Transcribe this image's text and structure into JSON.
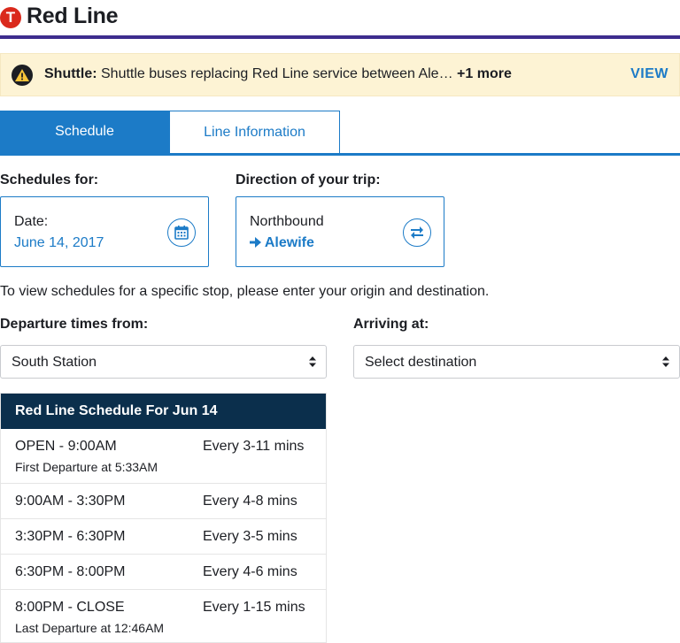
{
  "header": {
    "logo_text": "T",
    "title": "Red Line",
    "line_color": "#3d2d8e",
    "logo_color": "#da291c"
  },
  "alert": {
    "icon": "warning-icon",
    "label": "Shuttle:",
    "message": "Shuttle buses replacing Red Line service between Ale…",
    "more": "+1 more",
    "action": "VIEW"
  },
  "tabs": [
    {
      "label": "Schedule",
      "active": true
    },
    {
      "label": "Line Information",
      "active": false
    }
  ],
  "schedules_for": {
    "heading": "Schedules for:",
    "field_label": "Date:",
    "value": "June 14, 2017",
    "icon": "calendar-icon"
  },
  "direction": {
    "heading": "Direction of your trip:",
    "value": "Northbound",
    "destination": "Alewife",
    "icon": "swap-arrows-icon"
  },
  "helper_text": "To view schedules for a specific stop, please enter your origin and destination.",
  "departure": {
    "heading": "Departure times from:",
    "selected": "South Station"
  },
  "arriving": {
    "heading": "Arriving at:",
    "selected": "Select destination"
  },
  "schedule_table": {
    "title": "Red Line Schedule For Jun 14",
    "rows": [
      {
        "time": "OPEN - 9:00AM",
        "frequency": "Every 3-11 mins",
        "note": "First Departure at 5:33AM"
      },
      {
        "time": "9:00AM - 3:30PM",
        "frequency": "Every 4-8 mins",
        "note": ""
      },
      {
        "time": "3:30PM - 6:30PM",
        "frequency": "Every 3-5 mins",
        "note": ""
      },
      {
        "time": "6:30PM - 8:00PM",
        "frequency": "Every 4-6 mins",
        "note": ""
      },
      {
        "time": "8:00PM - CLOSE",
        "frequency": "Every 1-15 mins",
        "note": "Last Departure at 12:46AM"
      }
    ]
  },
  "colors": {
    "accent": "#1c7bc7",
    "table_header": "#0b2f4c",
    "alert_bg": "#fdf3d4"
  }
}
